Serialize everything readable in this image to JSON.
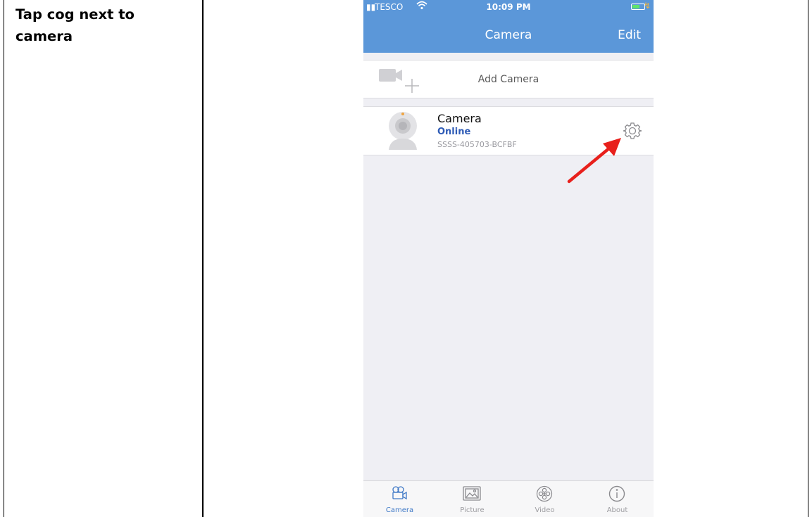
{
  "instruction": {
    "text": "Tap cog next to camera"
  },
  "status_bar": {
    "carrier": "TESCO",
    "time": "10:09 PM"
  },
  "navbar": {
    "title": "Camera",
    "edit_label": "Edit"
  },
  "add_camera": {
    "label": "Add Camera"
  },
  "camera_item": {
    "name": "Camera",
    "status": "Online",
    "serial": "SSSS-405703-BCFBF"
  },
  "tabs": [
    {
      "label": "Camera",
      "icon": "camera-tab-icon",
      "active": true
    },
    {
      "label": "Picture",
      "icon": "picture-tab-icon",
      "active": false
    },
    {
      "label": "Video",
      "icon": "video-tab-icon",
      "active": false
    },
    {
      "label": "About",
      "icon": "about-tab-icon",
      "active": false
    }
  ],
  "colors": {
    "navbar": "#5b97d9",
    "online": "#2e5bb6",
    "arrow": "#e8201c",
    "active_tab": "#3e78c6"
  }
}
